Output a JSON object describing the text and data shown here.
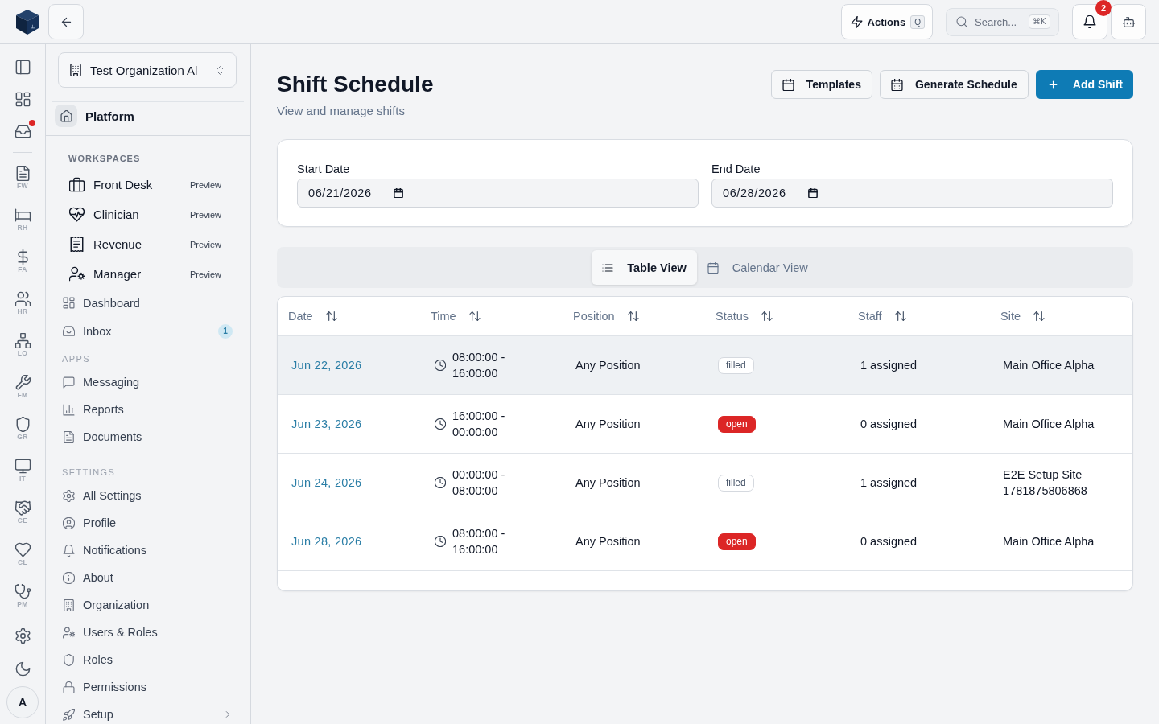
{
  "topbar": {
    "logo_mark": "E",
    "actions": {
      "label": "Actions",
      "shortcut": "Q"
    },
    "search": {
      "placeholder": "Search...",
      "shortcut": "⌘K"
    },
    "notifications": {
      "count": "2"
    }
  },
  "rail": {
    "top": [
      {
        "alert": false
      },
      {
        "alert": false
      },
      {
        "alert": true
      }
    ],
    "modules": [
      {
        "label": "FW"
      },
      {
        "label": "RH"
      },
      {
        "label": "FA"
      },
      {
        "label": "HR"
      },
      {
        "label": "LO"
      },
      {
        "label": "FM"
      },
      {
        "label": "GR"
      },
      {
        "label": "IT"
      },
      {
        "label": "CE"
      },
      {
        "label": "CL"
      },
      {
        "label": "PM"
      }
    ],
    "avatar": {
      "initial": "A"
    }
  },
  "sidebar": {
    "organization": "Test Organization Al",
    "platform": "Platform",
    "sections": [
      {
        "kind": "workspaces",
        "title": "WORKSPACES",
        "items": [
          {
            "label": "Front Desk",
            "tag": "Preview"
          },
          {
            "label": "Clinician",
            "tag": "Preview"
          },
          {
            "label": "Revenue",
            "tag": "Preview"
          },
          {
            "label": "Manager",
            "tag": "Preview"
          }
        ]
      },
      {
        "kind": "links",
        "items": [
          {
            "label": "Dashboard"
          },
          {
            "label": "Inbox",
            "badge": "1"
          }
        ]
      },
      {
        "kind": "links",
        "title": "APPS",
        "items": [
          {
            "label": "Messaging"
          },
          {
            "label": "Reports"
          },
          {
            "label": "Documents"
          }
        ]
      },
      {
        "kind": "links",
        "title": "SETTINGS",
        "items": [
          {
            "label": "All Settings"
          },
          {
            "label": "Profile"
          },
          {
            "label": "Notifications"
          },
          {
            "label": "About"
          },
          {
            "label": "Organization"
          },
          {
            "label": "Users & Roles"
          },
          {
            "label": "Roles"
          },
          {
            "label": "Permissions"
          },
          {
            "label": "Setup",
            "expandable": true
          }
        ]
      }
    ]
  },
  "page": {
    "title": "Shift Schedule",
    "subtitle": "View and manage shifts",
    "buttons": [
      {
        "label": "Templates",
        "kind": "outline"
      },
      {
        "label": "Generate Schedule",
        "kind": "outline"
      },
      {
        "label": "Add Shift",
        "kind": "primary"
      }
    ]
  },
  "filters": [
    {
      "label": "Start Date",
      "value": "06/21/2026"
    },
    {
      "label": "End Date",
      "value": "06/28/2026"
    }
  ],
  "views": [
    {
      "label": "Table View",
      "selected": true
    },
    {
      "label": "Calendar View",
      "selected": false
    }
  ],
  "table": {
    "columns": [
      "Date",
      "Time",
      "Position",
      "Status",
      "Staff",
      "Site"
    ],
    "rows": [
      {
        "date": "Jun 22, 2026",
        "time": "08:00:00 - 16:00:00",
        "position": "Any Position",
        "status": {
          "label": "filled",
          "kind": "outline"
        },
        "staff": "1 assigned",
        "site": "Main Office Alpha",
        "highlighted": true
      },
      {
        "date": "Jun 23, 2026",
        "time": "16:00:00 - 00:00:00",
        "position": "Any Position",
        "status": {
          "label": "open",
          "kind": "destructive"
        },
        "staff": "0 assigned",
        "site": "Main Office Alpha",
        "highlighted": false
      },
      {
        "date": "Jun 24, 2026",
        "time": "00:00:00 - 08:00:00",
        "position": "Any Position",
        "status": {
          "label": "filled",
          "kind": "outline"
        },
        "staff": "1 assigned",
        "site": "E2E Setup Site 1781875806868",
        "highlighted": false
      },
      {
        "date": "Jun 28, 2026",
        "time": "08:00:00 - 16:00:00",
        "position": "Any Position",
        "status": {
          "label": "open",
          "kind": "destructive"
        },
        "staff": "0 assigned",
        "site": "Main Office Alpha",
        "highlighted": false
      }
    ]
  }
}
